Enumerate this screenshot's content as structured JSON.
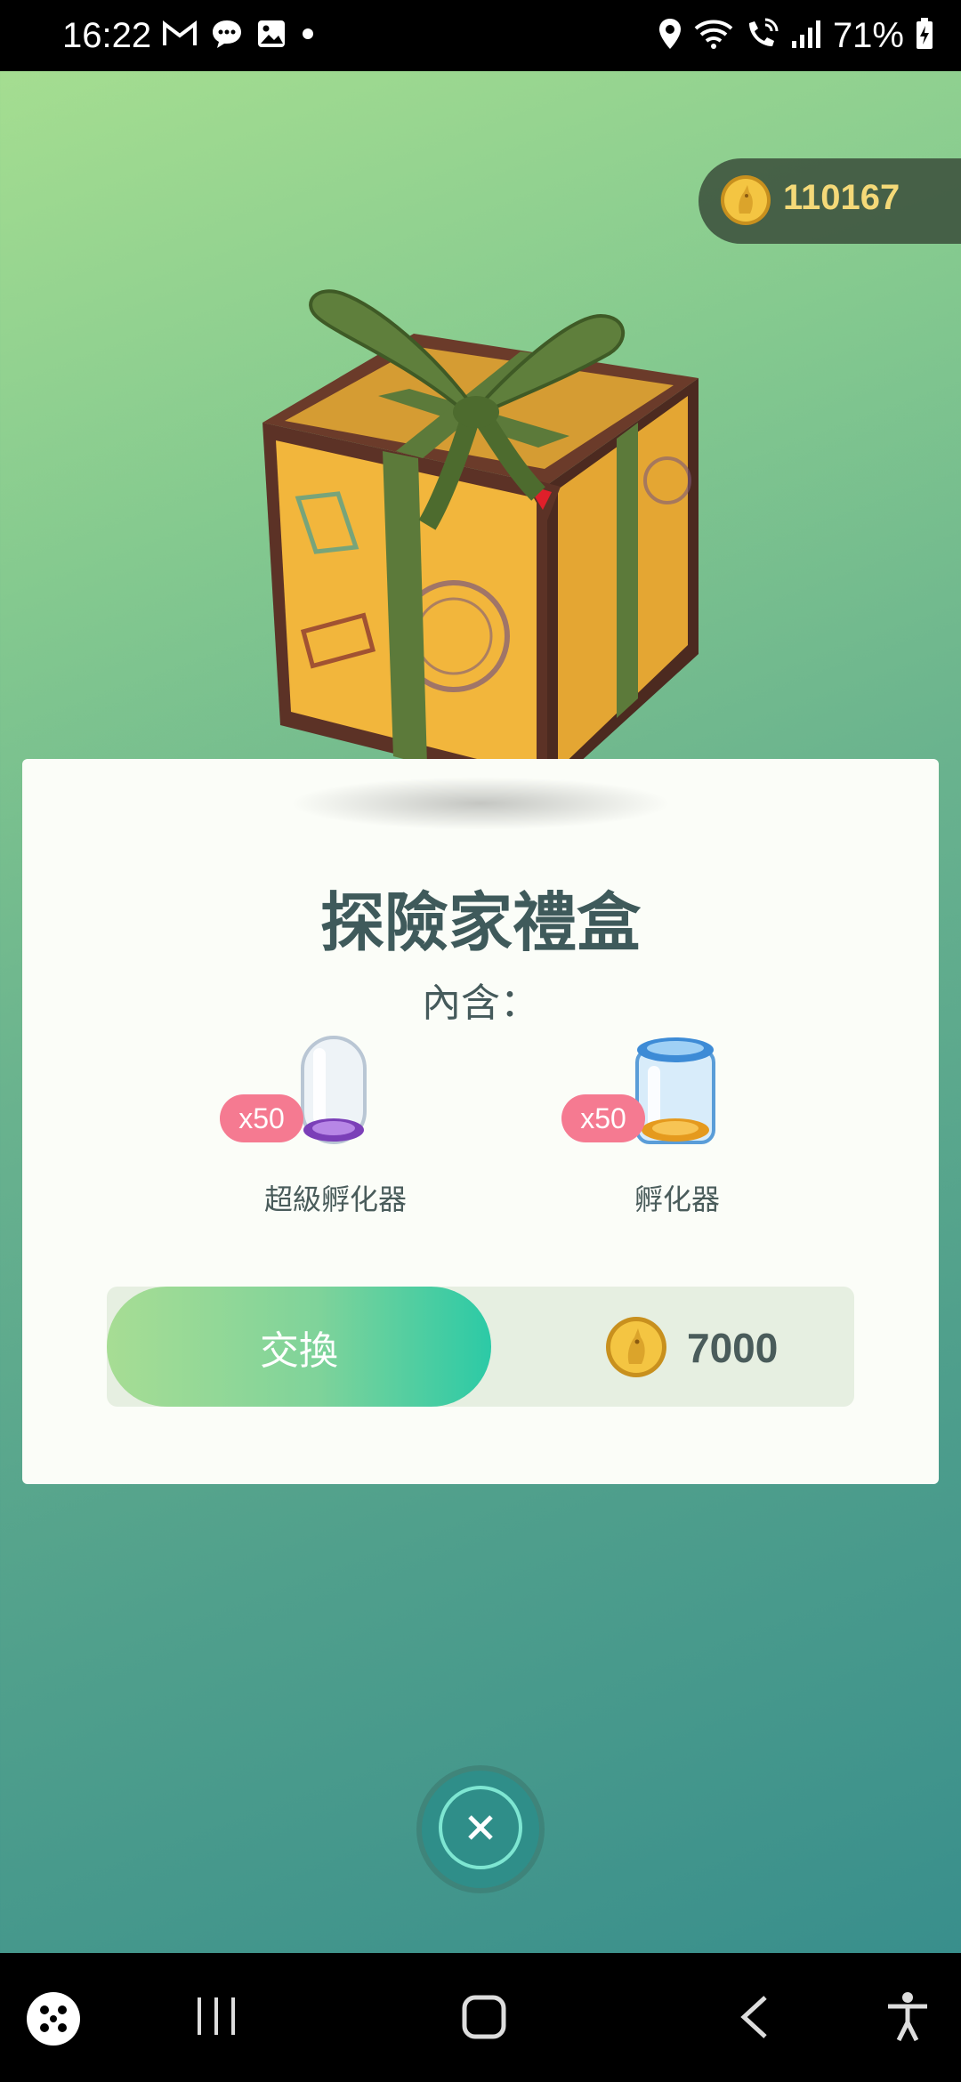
{
  "status_bar": {
    "time": "16:22",
    "battery": "71%",
    "notification_icons": [
      "gmail-icon",
      "chat-bubble-icon",
      "gallery-icon",
      "dot-icon"
    ],
    "system_icons": [
      "location-icon",
      "wifi-icon",
      "wifi-calling-icon",
      "signal-icon",
      "battery-charging-icon"
    ]
  },
  "header": {
    "coin_balance": "110167"
  },
  "offer": {
    "title": "探險家禮盒",
    "contains_label": "內含：",
    "items": [
      {
        "quantity": "x50",
        "name": "超級孵化器",
        "icon": "super-incubator-icon"
      },
      {
        "quantity": "x50",
        "name": "孵化器",
        "icon": "incubator-icon"
      }
    ],
    "exchange_label": "交換",
    "price": "7000"
  },
  "colors": {
    "accent_green": "#2ccaa6",
    "coin_gold": "#f4c542",
    "badge_pink": "#f57a91",
    "title_text": "#3f5a5b"
  },
  "nav_bar": {
    "icons": [
      "game-launcher-icon",
      "recent-apps-icon",
      "home-icon",
      "back-icon",
      "accessibility-icon"
    ]
  }
}
